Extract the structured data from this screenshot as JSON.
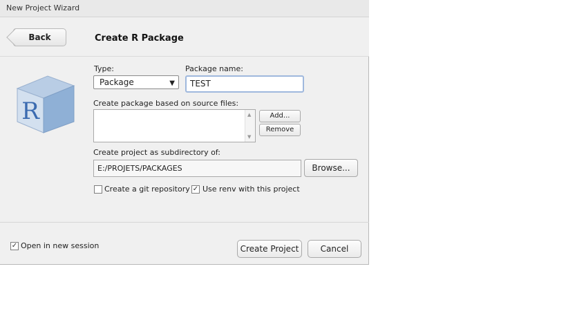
{
  "window": {
    "title": "New Project Wizard"
  },
  "header": {
    "back_label": "Back",
    "title": "Create R Package"
  },
  "logo": {
    "icon": "r-package-cube-icon",
    "letter": "R"
  },
  "form": {
    "type_label": "Type:",
    "type_value": "Package",
    "package_name_label": "Package name:",
    "package_name_value": "TEST",
    "source_files_label": "Create package based on source files:",
    "add_label": "Add...",
    "remove_label": "Remove",
    "subdirectory_label": "Create project as subdirectory of:",
    "subdirectory_value": "E:/PROJETS/PACKAGES",
    "browse_label": "Browse...",
    "git_label": "Create a git repository",
    "git_checked": false,
    "renv_label": "Use renv with this project",
    "renv_checked": true
  },
  "footer": {
    "open_session_label": "Open in new session",
    "open_session_checked": true,
    "create_label": "Create Project",
    "cancel_label": "Cancel"
  },
  "colors": {
    "dialog_bg": "#f0f0f0",
    "focus_border": "#9fb8dd",
    "logo_blue": "#7a9cc6"
  }
}
